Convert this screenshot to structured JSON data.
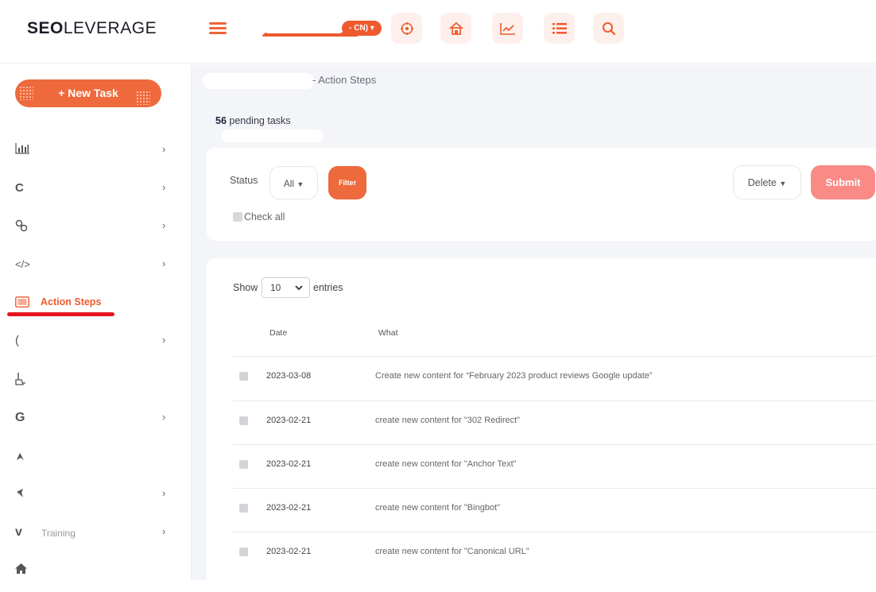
{
  "app": {
    "logo_bold": "SEO",
    "logo_light": "LEVERAGE",
    "lang_label": "- CN)",
    "brand_color": "#EE5A2E"
  },
  "topbar_icons": [
    "target-icon",
    "house-icon",
    "trend-chart-icon",
    "list-icon",
    "search-icon"
  ],
  "sidebar": {
    "new_task_label": "+ New Task",
    "items": [
      {
        "icon": "bar-chart-icon",
        "label": "",
        "chevron": true
      },
      {
        "icon": "crescent-icon",
        "label": "",
        "chevron": true
      },
      {
        "icon": "link-icon",
        "label": "",
        "chevron": true
      },
      {
        "icon": "code-icon",
        "label": "",
        "chevron": true
      },
      {
        "icon": "action-steps-icon",
        "label": "Action Steps",
        "chevron": false
      },
      {
        "icon": "paren-icon",
        "label": "",
        "chevron": true
      },
      {
        "icon": "broom-icon",
        "label": "",
        "chevron": false
      },
      {
        "icon": "google-icon",
        "label": "",
        "chevron": true
      },
      {
        "icon": "peak-icon",
        "label": "",
        "chevron": false
      },
      {
        "icon": "flag-icon",
        "label": "",
        "chevron": true
      },
      {
        "icon": "vimeo-icon",
        "label": "",
        "chevron": true
      },
      {
        "icon": "home-icon",
        "label": "",
        "chevron": false
      }
    ],
    "training_label": "Training"
  },
  "main": {
    "breadcrumb": "- Action Steps",
    "pending_count": "56",
    "pending_label": " pending tasks",
    "filters": {
      "status_label": "Status",
      "status_value": "All",
      "filter_label": "Filter",
      "delete_label": "Delete",
      "submit_label": "Submit",
      "checkall_label": "Check all"
    },
    "table": {
      "show_label": "Show",
      "entries_value": "10",
      "entries_label": "entries",
      "columns": [
        "Date",
        "What"
      ],
      "rows": [
        {
          "date": "2023-03-08",
          "what": "Create new content for “February 2023 product reviews Google update”"
        },
        {
          "date": "2023-02-21",
          "what": "create new content for \"302 Redirect\""
        },
        {
          "date": "2023-02-21",
          "what": "create new content for \"Anchor Text\""
        },
        {
          "date": "2023-02-21",
          "what": "create new content for \"Bingbot\""
        },
        {
          "date": "2023-02-21",
          "what": "create new content for \"Canonical URL\""
        }
      ]
    }
  }
}
